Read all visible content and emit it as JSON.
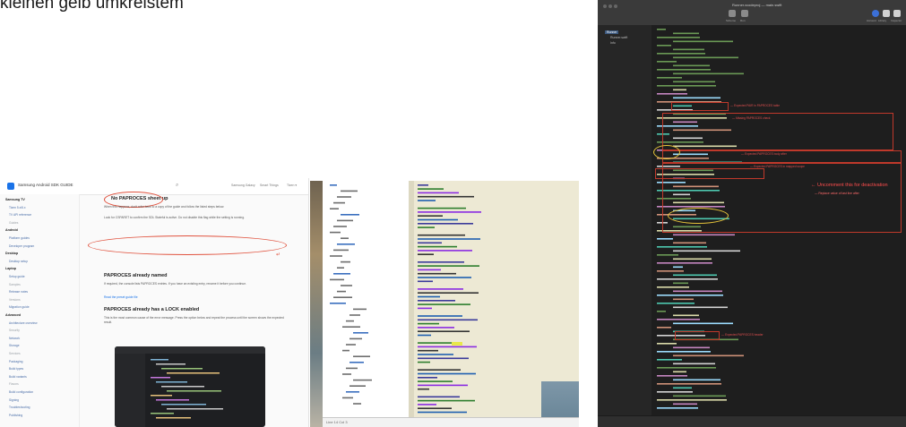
{
  "caption": "kleinen gelb umkreistem",
  "docs_panel": {
    "brand": "Samsung Android SDK GUIDE",
    "search_icon": "magnifier-icon",
    "top_nav": [
      "Samsung Galaxy",
      "Smart Things",
      "Tizen ▾"
    ],
    "sidebar": [
      {
        "label": "Samsung TV",
        "kind": "head"
      },
      {
        "label": "Tizen 5.x/6.x",
        "kind": "link"
      },
      {
        "label": "TV API reference",
        "kind": "link"
      },
      {
        "label": "Guides",
        "kind": "sub"
      },
      {
        "label": "Android",
        "kind": "head"
      },
      {
        "label": "Platform guides",
        "kind": "link"
      },
      {
        "label": "Developer program",
        "kind": "link"
      },
      {
        "label": "Desktop",
        "kind": "head"
      },
      {
        "label": "Desktop setup",
        "kind": "link"
      },
      {
        "label": "Laptop",
        "kind": "head"
      },
      {
        "label": "Setup guide",
        "kind": "link"
      },
      {
        "label": "Samples",
        "kind": "sub"
      },
      {
        "label": "Release notes",
        "kind": "link"
      },
      {
        "label": "Versions",
        "kind": "sub"
      },
      {
        "label": "Migration guide",
        "kind": "link"
      },
      {
        "label": "Advanced",
        "kind": "head"
      },
      {
        "label": "Architecture overview",
        "kind": "link"
      },
      {
        "label": "Security",
        "kind": "sub"
      },
      {
        "label": "Network",
        "kind": "link"
      },
      {
        "label": "Storage",
        "kind": "link"
      },
      {
        "label": "Services",
        "kind": "sub"
      },
      {
        "label": "Packaging",
        "kind": "link"
      },
      {
        "label": "Build types",
        "kind": "link"
      },
      {
        "label": "Build variants",
        "kind": "link"
      },
      {
        "label": "Flavors",
        "kind": "sub"
      },
      {
        "label": "Build configuration",
        "kind": "link"
      },
      {
        "label": "Signing",
        "kind": "link"
      },
      {
        "label": "Troubleshooting",
        "kind": "link"
      },
      {
        "label": "Publishing",
        "kind": "link"
      }
    ],
    "sections": [
      {
        "heading": "No PAPROCES sheet up",
        "body": "When this happens, don't refer back to a copy of the guide and follow the listed steps below."
      },
      {
        "heading": "PAPROCES already named",
        "body": "If required, the console lists PAPROCES entries. If you have an existing entry, rename it before you continue."
      },
      {
        "heading": "PAPROCES already has a LOCK enabled",
        "body": "This is the most common cause of the error message. Press the option below and repeat the process until the screen shows the expected result."
      }
    ],
    "note_text": "Look for CSPARET to confirm the SDL Stateful is active. Do not disable this flag while the setting is running.",
    "link_text": "Read the preset guide file"
  },
  "editor_panel": {
    "status_text": "Line 14  Col 3",
    "tree_rows": 38,
    "code_rows": 60
  },
  "ide_panel": {
    "title": "Runner.xcodeproj — main.swift",
    "toolbar": [
      {
        "label": "Scheme",
        "color": "#8a8a8a"
      },
      {
        "label": "Run",
        "color": "#8a8a8a"
      },
      {
        "label": "Account",
        "color": "#3b6fd6"
      },
      {
        "label": "Library",
        "color": "#d0d0d0"
      },
      {
        "label": "Inspector",
        "color": "#d0d0d0"
      }
    ],
    "nav_items": [
      {
        "label": "Runner",
        "selected": true
      },
      {
        "label": "Runner.swift",
        "selected": false
      },
      {
        "label": "Info",
        "selected": false
      }
    ],
    "err_labels": [
      "— Expected PAIR in PAPROCES table",
      "— Missing PAPROCES check",
      "— Expected PAPROCES body after",
      "— Expected PAPROCES in mapped scope"
    ],
    "note_big": "← Uncomment this for deactivation",
    "note_small": "— Replace value of last line after",
    "err_label_lower": "— Expected PAPROCES header"
  },
  "colors": {
    "circle_red": "#e0523e",
    "yellow_circle": "#e5c33a",
    "error_red": "#c0392b",
    "ide_bg": "#1e1e1e",
    "editor_bg": "#ede9d4"
  }
}
